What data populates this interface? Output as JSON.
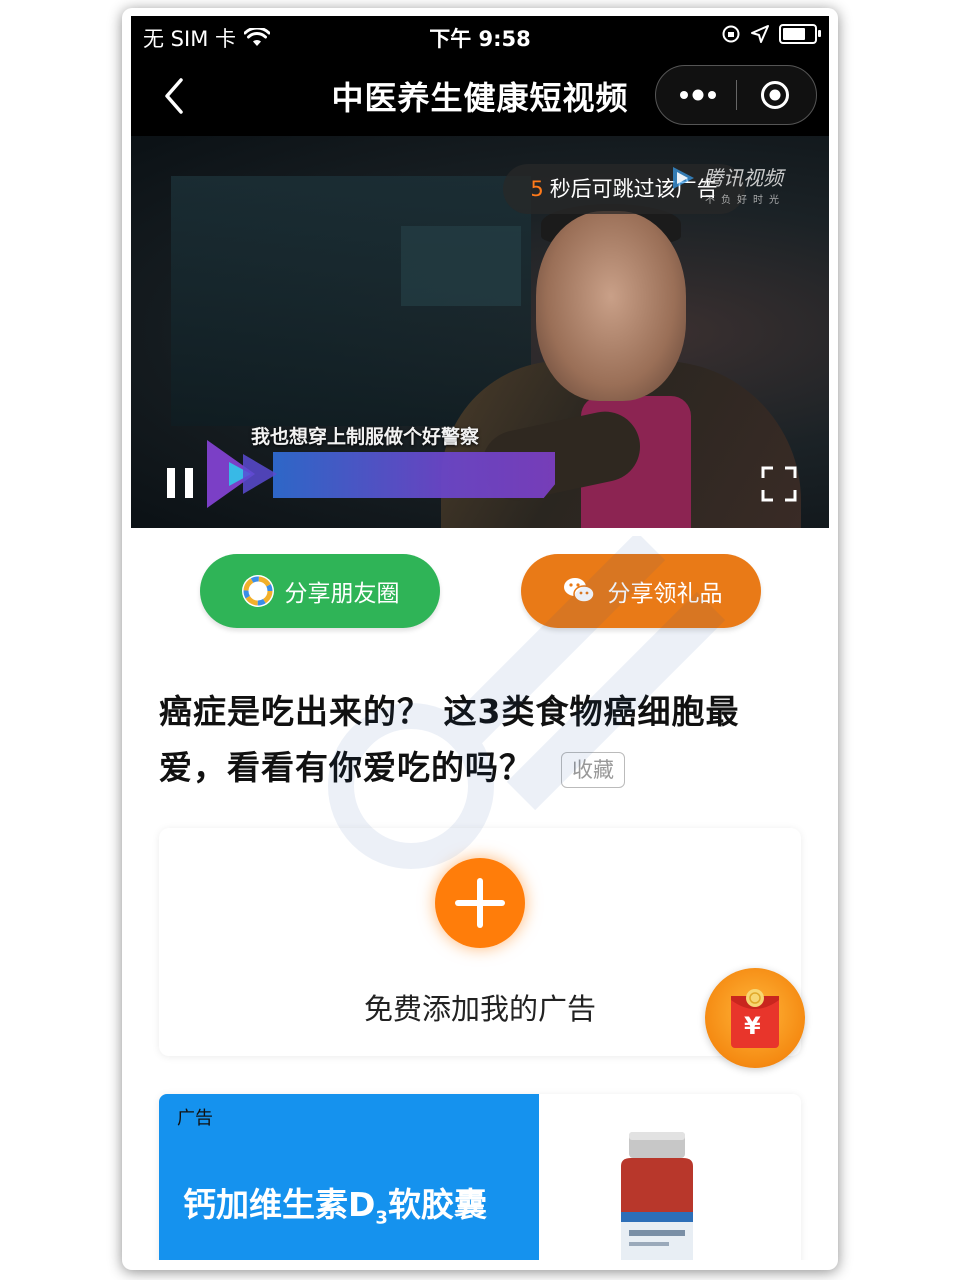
{
  "status_bar": {
    "carrier": "无 SIM 卡",
    "time": "下午 9:58"
  },
  "nav": {
    "title": "中医养生健康短视频"
  },
  "video": {
    "skip_countdown": "5",
    "skip_text": "秒后可跳过该广告",
    "brand_name": "腾讯视频",
    "brand_slogan": "不负好时光",
    "subtitle": "我也想穿上制服做个好警察"
  },
  "share": {
    "moments_label": "分享朋友圈",
    "gift_label": "分享领礼品"
  },
  "article": {
    "title": "癌症是吃出来的？ 这3类食物癌细胞最爱，看看有你爱吃的吗？",
    "favorite_label": "收藏"
  },
  "ad_slot": {
    "label": "免费添加我的广告",
    "redpack_symbol": "¥"
  },
  "product_ad": {
    "tag": "广告",
    "name_main": "钙加维生素D",
    "name_sub": "3",
    "name_tail": "软胶囊"
  },
  "colors": {
    "share_green": "#2fb457",
    "share_orange": "#e97a17",
    "accent_orange": "#ff7d0a",
    "ad_blue": "#1592ee"
  }
}
